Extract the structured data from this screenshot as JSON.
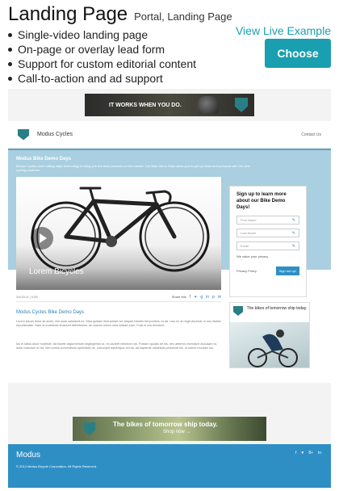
{
  "template": {
    "title": "Landing Page",
    "subtitle": "Portal, Landing Page",
    "features": [
      "Single-video landing page",
      "On-page or overlay lead form",
      "Support for custom editorial content",
      "Call-to-action and ad support"
    ],
    "view_live_label": "View Live Example",
    "choose_label": "Choose"
  },
  "preview": {
    "top_ad_text": "IT WORKS WHEN YOU DO.",
    "brand": "Modus Cycles",
    "contact_label": "Contact Us",
    "hero_title": "Modus Bike Demo Days",
    "hero_text": "Modus Cycles uses cutting edge technology to bring you the best products on the market. Our Bike Demo Days allow you to get up close and personal with the best cycling products.",
    "video_caption": "Lorem Bicycles",
    "date": "3/4/2014 | 0:58",
    "share_label": "Share this",
    "article_title": "Modus Cycles Bike Demo Days",
    "paragraph1": "Lorem ipsum dolor sit amet, mel suas salutandi ex. Mea quidam liberavisse ad, aliquid lobortis temporibus cu ad. Usu ex an fugit docendi, in usu facilisi repudiandae. Nam id molestiae tincidunt definitiones, an utamur tritani mea vidisse eum. Fuisi in nisl tincidunt.",
    "paragraph2": "Ius ei latius dolor molestie. Ad facete argumentum neglegentur ut, no iuvaret minimum an. Possim quodsi ne his, nec aeterno vivendum accusam id, dolor maiorum in his. Mel omnis conventione splendide ne, corrumpit reprimique vel ea. Ad sapiente urbanitas persecuti his, ut minim munium ius.",
    "form": {
      "title": "Sign up to learn more about our Bike Demo Days!",
      "first_name_placeholder": "First Name",
      "last_name_placeholder": "Last Name",
      "email_placeholder": "Email",
      "privacy_note": "We value your privacy",
      "privacy_policy_label": "Privacy Policy",
      "submit_label": "Sign me up!"
    },
    "side_ad_text": "The bikes of tomorrow ship today.",
    "bottom_ad_text": "The bikes of tomorrow ship today.",
    "bottom_ad_cta": "Shop now →",
    "footer_brand": "Modus",
    "footer_copy": "© 2014 Modus Bicycle Corporation. All Rights Reserved.",
    "social": [
      "f",
      "♥",
      "8+",
      "in"
    ]
  },
  "colors": {
    "accent": "#1a9fb0",
    "hero_blue": "#a9cfe0",
    "footer_blue": "#2e8fc5"
  }
}
